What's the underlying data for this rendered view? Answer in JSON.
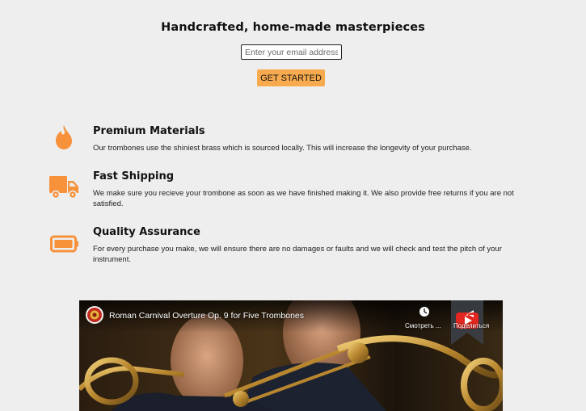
{
  "hero": {
    "title": "Handcrafted, home-made masterpieces",
    "email_placeholder": "Enter your email address",
    "cta_label": "GET STARTED"
  },
  "features": [
    {
      "icon": "fire-icon",
      "title": "Premium Materials",
      "description": "Our trombones use the shiniest brass which is sourced locally. This will increase the longevity of your purchase."
    },
    {
      "icon": "truck-icon",
      "title": "Fast Shipping",
      "description": "We make sure you recieve your trombone as soon as we have finished making it. We also provide free returns if you are not satisfied."
    },
    {
      "icon": "battery-icon",
      "title": "Quality Assurance",
      "description": "For every purchase you make, we will ensure there are no damages or faults and we will check and test the pitch of your instrument."
    }
  ],
  "video": {
    "title": "Roman Carnival Overture Op. 9 for Five Trombones",
    "watch_later_label": "Смотреть ...",
    "share_label": "Поделиться"
  },
  "colors": {
    "accent": "#f8ab4e",
    "icon_orange": "#f7913a",
    "background": "#eeeeee"
  }
}
